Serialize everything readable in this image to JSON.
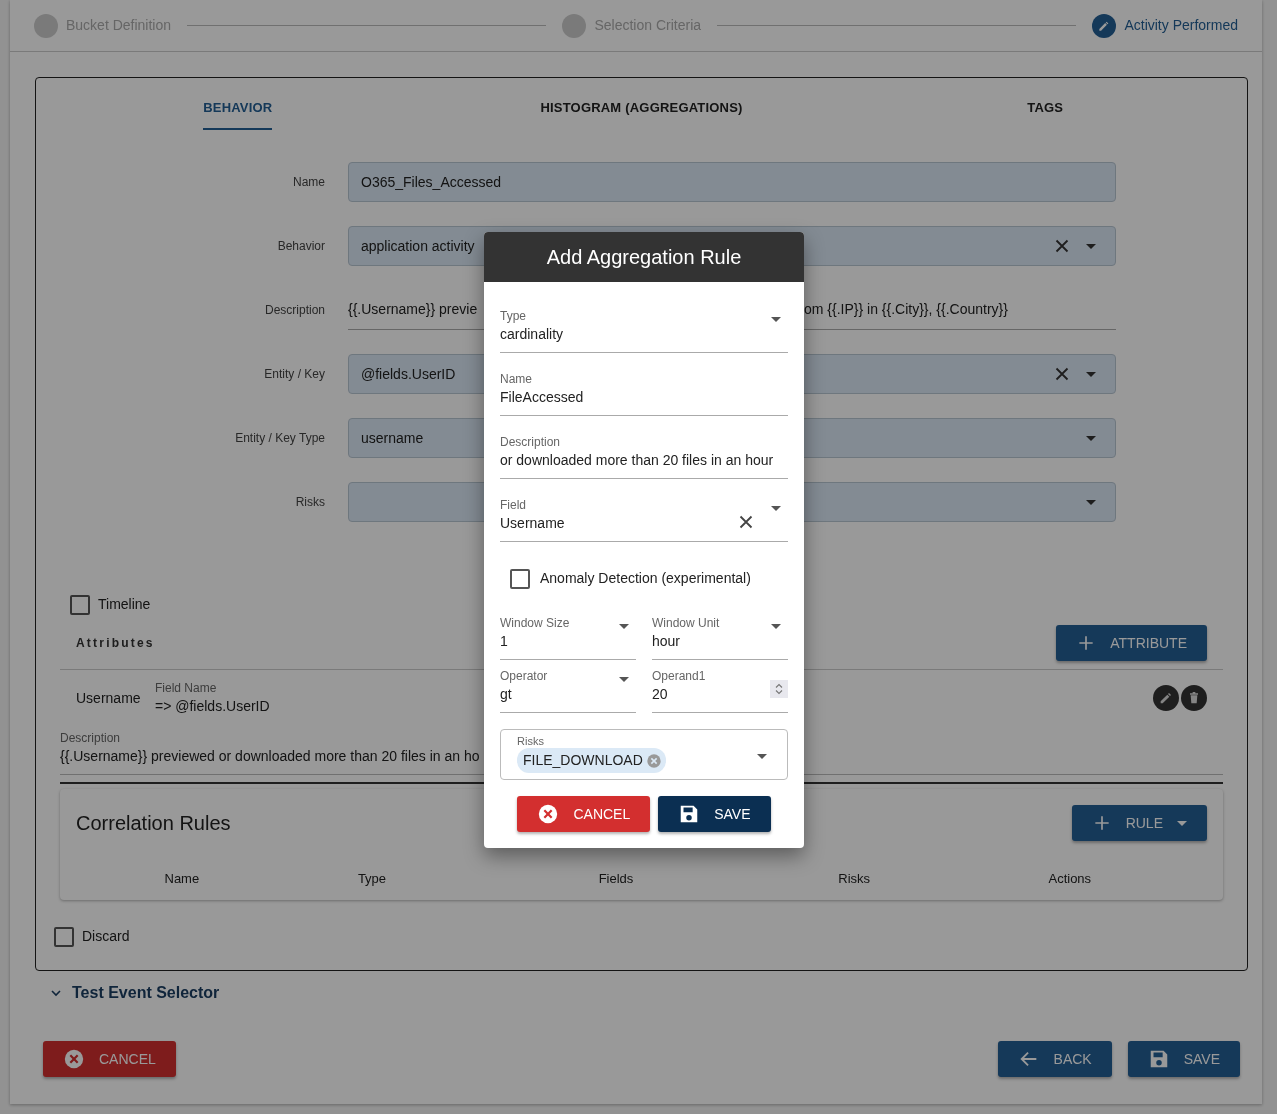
{
  "stepper": [
    {
      "label": "Bucket Definition",
      "active": false
    },
    {
      "label": "Selection Criteria",
      "active": false
    },
    {
      "label": "Activity Performed",
      "active": true
    }
  ],
  "tabs": [
    {
      "label": "BEHAVIOR",
      "selected": true
    },
    {
      "label": "HISTOGRAM (AGGREGATIONS)",
      "selected": false
    },
    {
      "label": "TAGS",
      "selected": false
    }
  ],
  "form": [
    {
      "label": "Name",
      "kind": "text",
      "value": "O365_Files_Accessed"
    },
    {
      "label": "Behavior",
      "kind": "select",
      "value": "application activity",
      "clearable": true
    },
    {
      "label": "Description",
      "kind": "description",
      "value": "{{.Username}} previe",
      "value_continued": "om {{.IP}} in {{.City}}, {{.Country}}"
    },
    {
      "label": "Entity / Key",
      "kind": "select",
      "value": "@fields.UserID",
      "clearable": true
    },
    {
      "label": "Entity / Key Type",
      "kind": "select",
      "value": "username",
      "clearable": false
    },
    {
      "label": "Risks",
      "kind": "select",
      "clearable": false
    }
  ],
  "timeline": {
    "label": "Timeline",
    "checked": false
  },
  "attributes": {
    "heading": "Attributes",
    "add_button": "ATTRIBUTE",
    "items": [
      {
        "name": "Username",
        "field_label": "Field Name",
        "field_value": "=> @fields.UserID",
        "description_label": "Description",
        "description": "{{.Username}} previewed or downloaded more than 20 files in an ho"
      }
    ]
  },
  "correlation_rules": {
    "title": "Correlation Rules",
    "add_button": "RULE",
    "columns": [
      "Name",
      "Type",
      "Fields",
      "Risks",
      "Actions"
    ]
  },
  "discard": {
    "label": "Discard",
    "checked": false
  },
  "test_event_selector": {
    "label": "Test Event Selector",
    "expanded": false
  },
  "footer": {
    "cancel": "CANCEL",
    "back": "BACK",
    "save": "SAVE"
  },
  "dialog": {
    "title": "Add Aggregation Rule",
    "fields": [
      {
        "label": "Type",
        "kind": "select",
        "value": "cardinality",
        "clearable": false
      },
      {
        "label": "Name",
        "kind": "text",
        "value": "FileAccessed"
      },
      {
        "label": "Description",
        "kind": "text",
        "value": "or downloaded more than 20 files in an hour"
      },
      {
        "label": "Field",
        "kind": "select",
        "value": "Username",
        "clearable": true
      }
    ],
    "anomaly_detection": {
      "label": "Anomaly Detection (experimental)",
      "checked": false
    },
    "paired_fields": [
      {
        "label": "Window Size",
        "kind": "select",
        "value": "1",
        "clearable": false
      },
      {
        "label": "Window Unit",
        "kind": "select",
        "value": "hour",
        "clearable": false
      },
      {
        "label": "Operator",
        "kind": "select",
        "value": "gt",
        "clearable": false
      },
      {
        "label": "Operand1",
        "kind": "number",
        "value": "20"
      }
    ],
    "risks": {
      "label": "Risks",
      "chips": [
        "FILE_DOWNLOAD"
      ]
    },
    "cancel": "CANCEL",
    "save": "SAVE"
  }
}
